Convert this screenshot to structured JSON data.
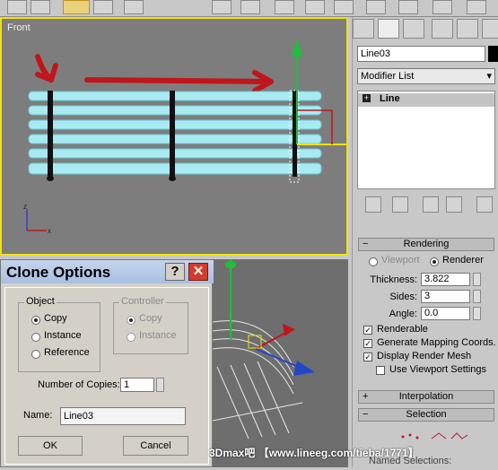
{
  "viewport_front": {
    "label": "Front"
  },
  "panel": {
    "object_name": "Line03",
    "modifier_list": "Modifier List",
    "stack_item": "Line",
    "rendering": {
      "header": "Rendering",
      "viewport_label": "Viewport",
      "renderer_label": "Renderer",
      "thickness_label": "Thickness:",
      "thickness_value": "3.822",
      "sides_label": "Sides:",
      "sides_value": "3",
      "angle_label": "Angle:",
      "angle_value": "0.0",
      "renderable": "Renderable",
      "gen_mapping": "Generate Mapping Coords.",
      "display_render_mesh": "Display Render Mesh",
      "use_viewport_settings": "Use Viewport Settings"
    },
    "interpolation_header": "Interpolation",
    "selection_header": "Selection",
    "named_selections": "Named Selections:"
  },
  "dialog": {
    "title": "Clone Options",
    "help_btn": "?",
    "object_group": "Object",
    "copy": "Copy",
    "instance": "Instance",
    "reference": "Reference",
    "controller_group": "Controller",
    "ctrl_copy": "Copy",
    "ctrl_instance": "Instance",
    "copies_label": "Number of Copies:",
    "copies_value": "1",
    "name_label": "Name:",
    "name_value": "Line03",
    "ok": "OK",
    "cancel": "Cancel"
  },
  "watermark": "3Dmax吧 【www.lineeg.com/tieba/1771】",
  "colors": {
    "active_border": "#f4e200",
    "bench": "#a8eaf2",
    "arrow": "#c0161b"
  }
}
